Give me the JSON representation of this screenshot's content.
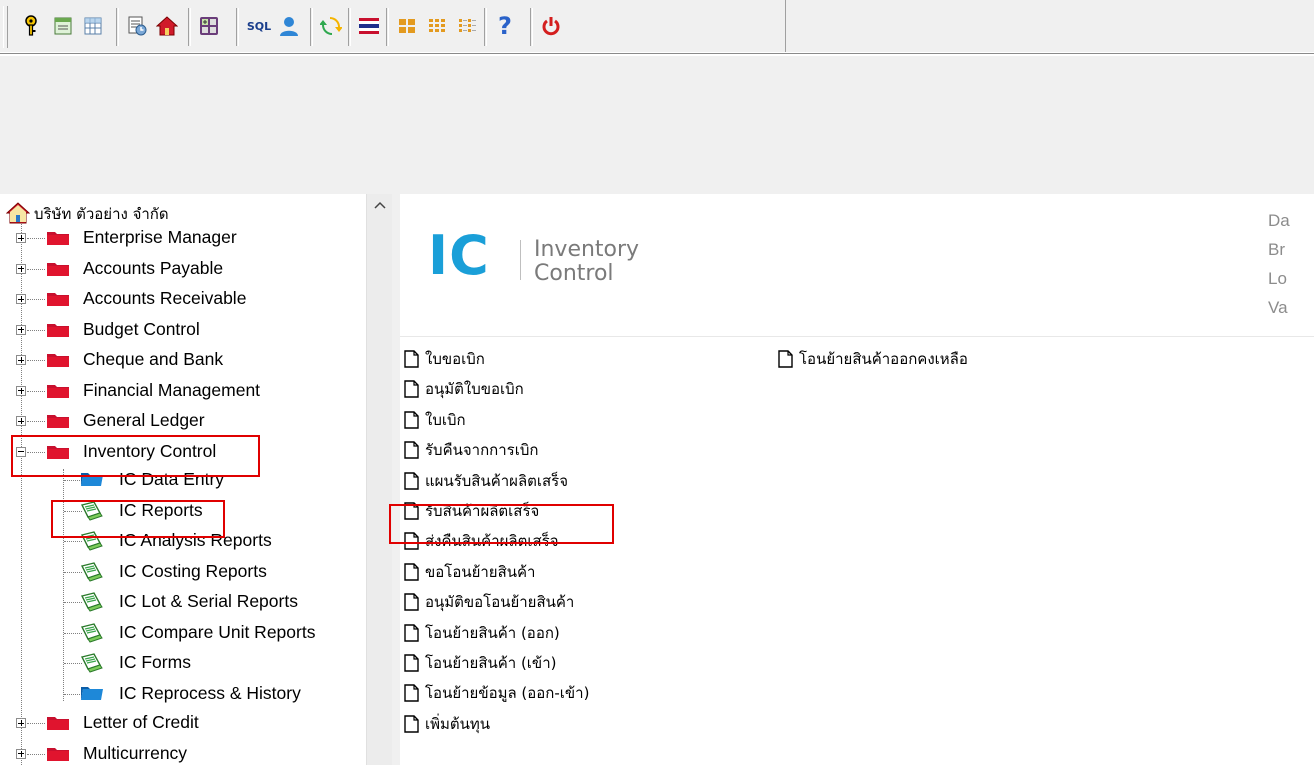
{
  "toolbar": {
    "buttons": [
      {
        "name": "key-icon",
        "tip": ""
      },
      {
        "name": "form-icon",
        "tip": ""
      },
      {
        "name": "grid-icon",
        "tip": ""
      },
      {
        "name": "schedule-icon",
        "tip": ""
      },
      {
        "name": "home-icon",
        "tip": ""
      },
      {
        "name": "calculator-icon",
        "tip": ""
      },
      {
        "name": "sql-icon",
        "label": "SQL"
      },
      {
        "name": "user-icon",
        "tip": ""
      },
      {
        "name": "refresh-icon",
        "tip": ""
      },
      {
        "name": "flag-icon",
        "tip": ""
      },
      {
        "name": "large-icons-view-icon",
        "tip": ""
      },
      {
        "name": "small-icons-view-icon",
        "tip": ""
      },
      {
        "name": "list-view-icon",
        "tip": ""
      },
      {
        "name": "help-icon",
        "label": "?"
      },
      {
        "name": "power-icon",
        "tip": ""
      }
    ]
  },
  "tree": {
    "root": "บริษัท ตัวอย่าง จำกัด",
    "modules": [
      "Enterprise Manager",
      "Accounts Payable",
      "Accounts Receivable",
      "Budget Control",
      "Cheque and Bank",
      "Financial Management",
      "General Ledger",
      "Inventory Control"
    ],
    "inventory_children": [
      "IC Data Entry",
      "IC Reports",
      "IC Analysis Reports",
      "IC Costing Reports",
      "IC Lot & Serial Reports",
      "IC Compare Unit Reports",
      "IC Forms",
      "IC Reprocess & History"
    ],
    "modules_after": [
      "Letter of Credit",
      "Multicurrency"
    ]
  },
  "banner": {
    "code": "IC",
    "title_line1": "Inventory",
    "title_line2": "Control",
    "right_labels": [
      "Da",
      "Br",
      "Lo",
      "Va"
    ]
  },
  "menu": {
    "column1": [
      "ใบขอเบิก",
      "อนุมัติใบขอเบิก",
      "ใบเบิก",
      "รับคืนจากการเบิก",
      "แผนรับสินค้าผลิตเสร็จ",
      "รับสินค้าผลิตเสร็จ",
      "ส่งคืนสินค้าผลิตเสร็จ",
      "ขอโอนย้ายสินค้า",
      "อนุมัติขอโอนย้ายสินค้า",
      "โอนย้ายสินค้า (ออก)",
      "โอนย้ายสินค้า (เข้า)",
      "โอนย้ายข้อมูล (ออก-เข้า)",
      "เพิ่มต้นทุน"
    ],
    "column2": [
      "โอนย้ายสินค้าออกคงเหลือ"
    ]
  },
  "colors": {
    "highlight": "#e00000",
    "brand_blue": "#1a9fd8",
    "folder_red": "#c8102e",
    "folder_blue": "#1e88d8"
  }
}
